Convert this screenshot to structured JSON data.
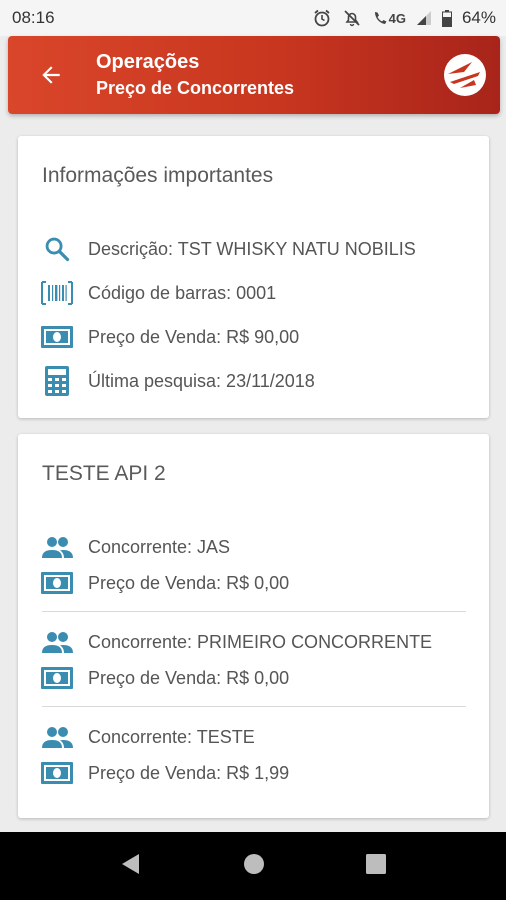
{
  "status_bar": {
    "time": "08:16",
    "network": "4G",
    "battery": "64%"
  },
  "app_bar": {
    "title": "Operações",
    "subtitle": "Preço de Concorrentes"
  },
  "info_card": {
    "title": "Informações importantes",
    "rows": [
      {
        "icon": "search-icon",
        "text": "Descrição: TST WHISKY NATU NOBILIS"
      },
      {
        "icon": "barcode-icon",
        "text": "Código de barras: 0001"
      },
      {
        "icon": "money-icon",
        "text": "Preço de Venda: R$ 90,00"
      },
      {
        "icon": "calculator-icon",
        "text": "Última pesquisa: 23/11/2018"
      }
    ]
  },
  "competitor_card": {
    "title": "TESTE API 2",
    "competitors": [
      {
        "name": "Concorrente: JAS",
        "price": "Preço de Venda: R$ 0,00"
      },
      {
        "name": "Concorrente: PRIMEIRO CONCORRENTE",
        "price": "Preço de Venda: R$ 0,00"
      },
      {
        "name": "Concorrente: TESTE",
        "price": "Preço de Venda: R$ 1,99"
      }
    ]
  },
  "colors": {
    "accent": "#cc3b22",
    "icon": "#3a8db0"
  }
}
